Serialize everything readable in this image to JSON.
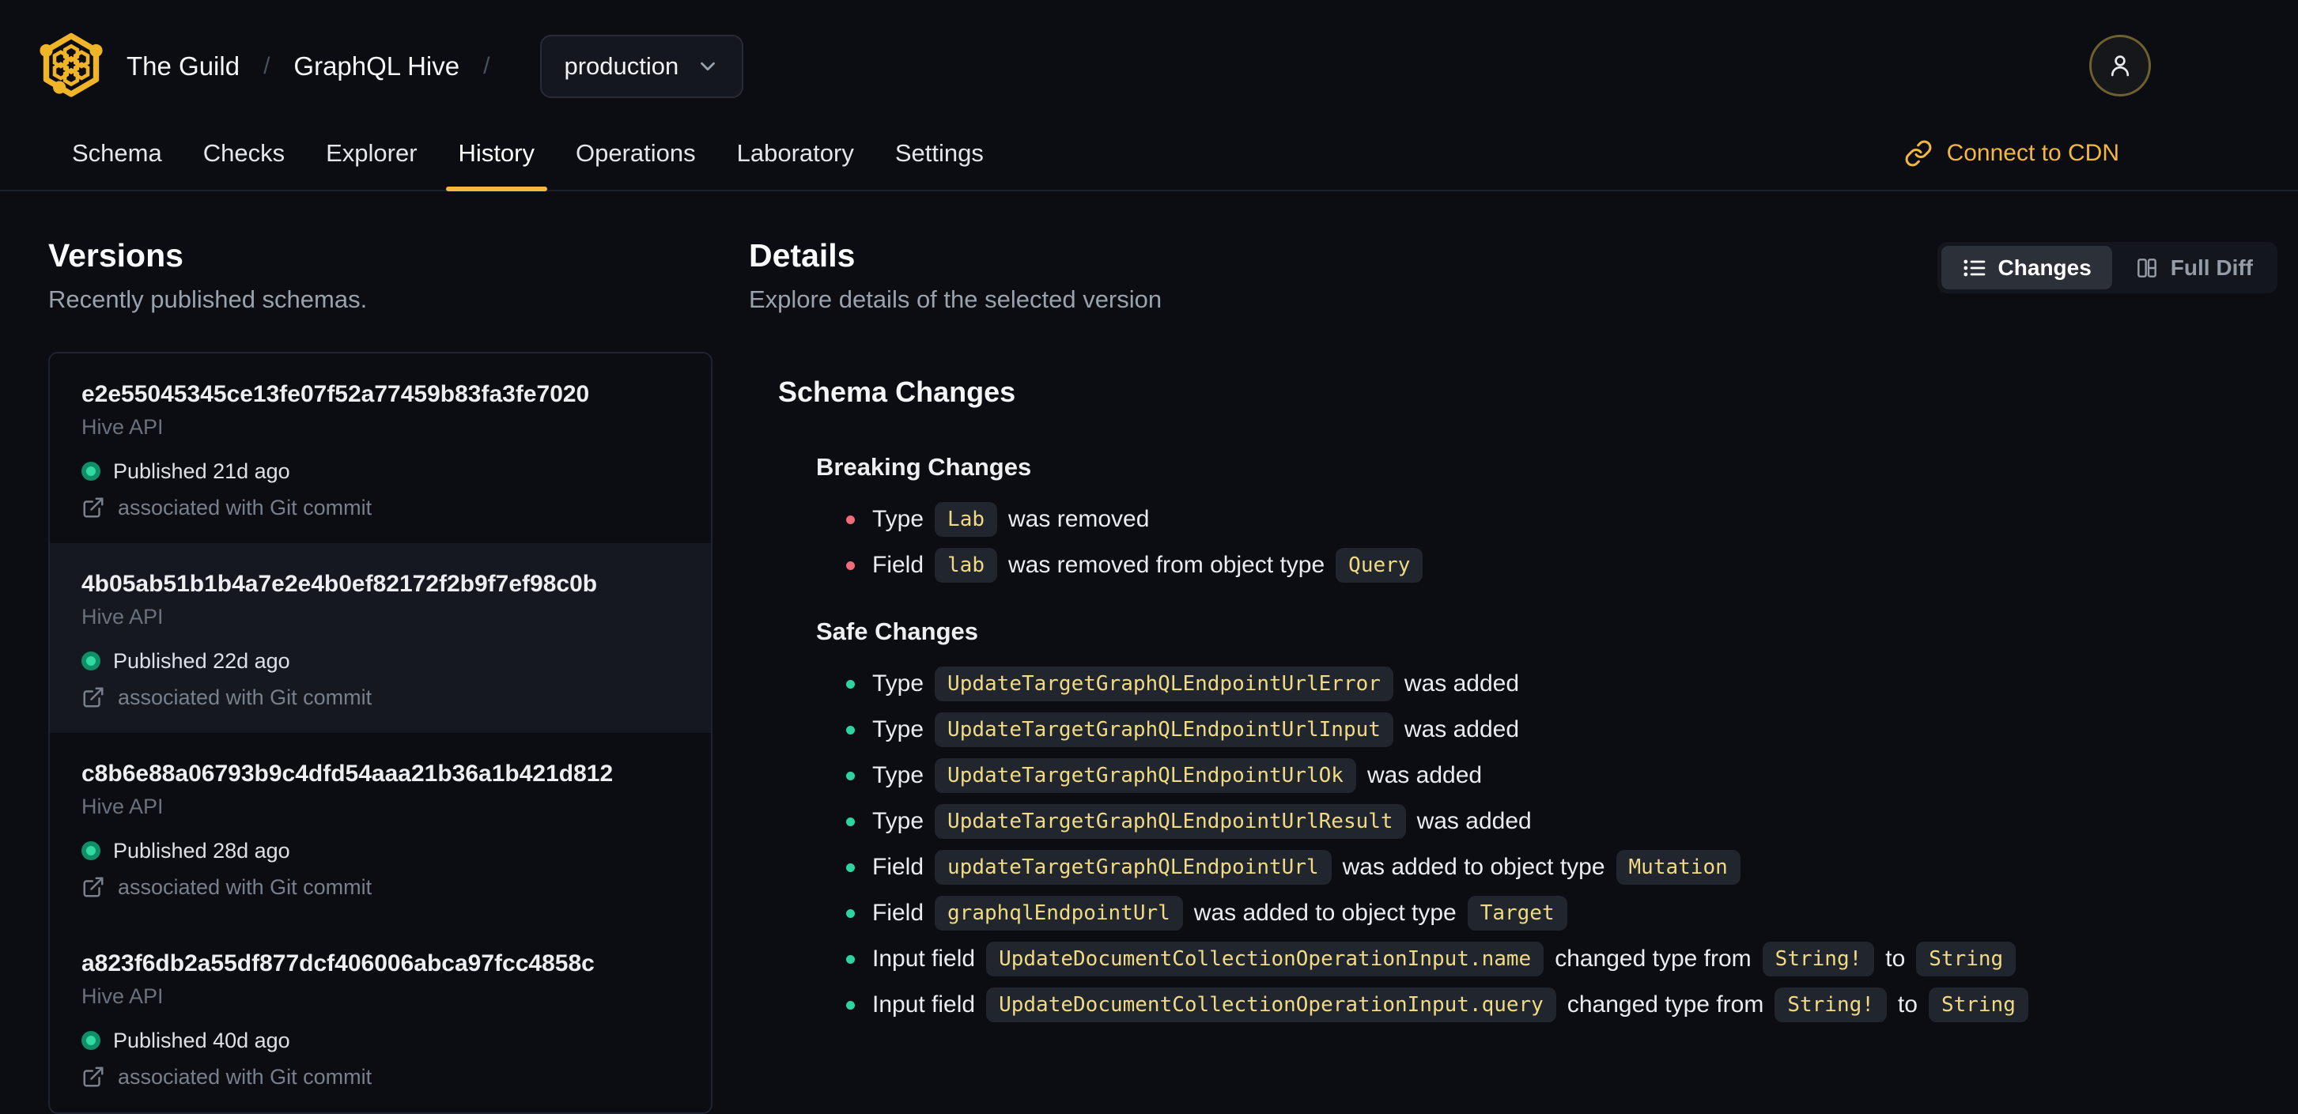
{
  "colors": {
    "accent": "#f4b740",
    "breaking_bullet": "#ee6d7a",
    "safe_bullet": "#2ed3a2",
    "published_dot_core": "#32d9a0",
    "published_dot_ring": "#0e8f68",
    "chip_text": "#f0db84"
  },
  "icons": {
    "logo": "hive-honeycomb",
    "target_selector": "chevron-down",
    "user_menu": "person",
    "cdn": "link",
    "changes_view": "list",
    "full_diff_view": "columns",
    "git_association": "external-link",
    "published_status": "dot"
  },
  "header": {
    "breadcrumb": {
      "org": "The Guild",
      "separator": "/",
      "project": "GraphQL Hive",
      "target": "production"
    },
    "tabs": [
      {
        "label": "Schema",
        "active": false
      },
      {
        "label": "Checks",
        "active": false
      },
      {
        "label": "Explorer",
        "active": false
      },
      {
        "label": "History",
        "active": true
      },
      {
        "label": "Operations",
        "active": false
      },
      {
        "label": "Laboratory",
        "active": false
      },
      {
        "label": "Settings",
        "active": false
      }
    ],
    "cdn_link": "Connect to CDN"
  },
  "versions": {
    "title": "Versions",
    "subtitle": "Recently published schemas.",
    "items": [
      {
        "hash": "e2e55045345ce13fe07f52a77459b83fa3fe7020",
        "target": "Hive API",
        "published": "Published 21d ago",
        "git": "associated with Git commit",
        "selected": false
      },
      {
        "hash": "4b05ab51b1b4a7e2e4b0ef82172f2b9f7ef98c0b",
        "target": "Hive API",
        "published": "Published 22d ago",
        "git": "associated with Git commit",
        "selected": true
      },
      {
        "hash": "c8b6e88a06793b9c4dfd54aaa21b36a1b421d812",
        "target": "Hive API",
        "published": "Published 28d ago",
        "git": "associated with Git commit",
        "selected": false
      },
      {
        "hash": "a823f6db2a55df877dcf406006abca97fcc4858c",
        "target": "Hive API",
        "published": "Published 40d ago",
        "git": "associated with Git commit",
        "selected": false
      }
    ]
  },
  "details": {
    "title": "Details",
    "subtitle": "Explore details of the selected version",
    "view_toggle": {
      "changes": "Changes",
      "full_diff": "Full Diff"
    },
    "schema_changes": {
      "title": "Schema Changes",
      "groups": [
        {
          "name": "Breaking Changes",
          "bullet_color": "#ee6d7a",
          "rows": [
            [
              {
                "t": "text",
                "v": "Type"
              },
              {
                "t": "code",
                "v": "Lab"
              },
              {
                "t": "text",
                "v": "was removed"
              }
            ],
            [
              {
                "t": "text",
                "v": "Field"
              },
              {
                "t": "code",
                "v": "lab"
              },
              {
                "t": "text",
                "v": "was removed from object type"
              },
              {
                "t": "code",
                "v": "Query"
              }
            ]
          ]
        },
        {
          "name": "Safe Changes",
          "bullet_color": "#2ed3a2",
          "rows": [
            [
              {
                "t": "text",
                "v": "Type"
              },
              {
                "t": "code",
                "v": "UpdateTargetGraphQLEndpointUrlError"
              },
              {
                "t": "text",
                "v": "was added"
              }
            ],
            [
              {
                "t": "text",
                "v": "Type"
              },
              {
                "t": "code",
                "v": "UpdateTargetGraphQLEndpointUrlInput"
              },
              {
                "t": "text",
                "v": "was added"
              }
            ],
            [
              {
                "t": "text",
                "v": "Type"
              },
              {
                "t": "code",
                "v": "UpdateTargetGraphQLEndpointUrlOk"
              },
              {
                "t": "text",
                "v": "was added"
              }
            ],
            [
              {
                "t": "text",
                "v": "Type"
              },
              {
                "t": "code",
                "v": "UpdateTargetGraphQLEndpointUrlResult"
              },
              {
                "t": "text",
                "v": "was added"
              }
            ],
            [
              {
                "t": "text",
                "v": "Field"
              },
              {
                "t": "code",
                "v": "updateTargetGraphQLEndpointUrl"
              },
              {
                "t": "text",
                "v": "was added to object type"
              },
              {
                "t": "code",
                "v": "Mutation"
              }
            ],
            [
              {
                "t": "text",
                "v": "Field"
              },
              {
                "t": "code",
                "v": "graphqlEndpointUrl"
              },
              {
                "t": "text",
                "v": "was added to object type"
              },
              {
                "t": "code",
                "v": "Target"
              }
            ],
            [
              {
                "t": "text",
                "v": "Input field"
              },
              {
                "t": "code",
                "v": "UpdateDocumentCollectionOperationInput.name"
              },
              {
                "t": "text",
                "v": "changed type from"
              },
              {
                "t": "code",
                "v": "String!"
              },
              {
                "t": "text",
                "v": "to"
              },
              {
                "t": "code",
                "v": "String"
              }
            ],
            [
              {
                "t": "text",
                "v": "Input field"
              },
              {
                "t": "code",
                "v": "UpdateDocumentCollectionOperationInput.query"
              },
              {
                "t": "text",
                "v": "changed type from"
              },
              {
                "t": "code",
                "v": "String!"
              },
              {
                "t": "text",
                "v": "to"
              },
              {
                "t": "code",
                "v": "String"
              }
            ]
          ]
        }
      ]
    }
  }
}
